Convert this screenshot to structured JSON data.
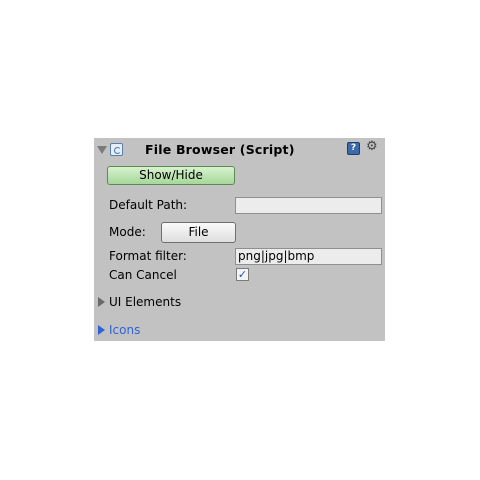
{
  "component": {
    "title": "File Browser (Script)",
    "help_icon": "help-book-icon",
    "gear_icon": "gear-icon",
    "script_icon": "csharp-script-icon"
  },
  "show_hide_button": "Show/Hide",
  "fields": {
    "default_path_label": "Default Path:",
    "default_path_value": "",
    "mode_label": "Mode:",
    "mode_value": "File",
    "format_filter_label": "Format filter:",
    "format_filter_value": "png|jpg|bmp",
    "can_cancel_label": "Can Cancel",
    "can_cancel_checked": true
  },
  "foldouts": {
    "ui_elements": "UI Elements",
    "icons": "Icons"
  },
  "colors": {
    "panel_bg": "#c2c2c2",
    "button_green": "#b8e3ad",
    "link_blue": "#2f62d6",
    "checkbox_mark": "#1d57b8"
  }
}
